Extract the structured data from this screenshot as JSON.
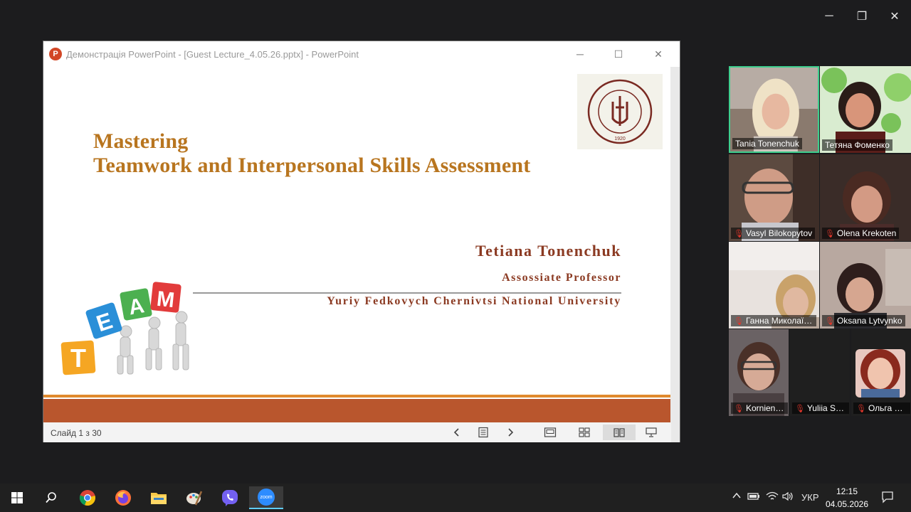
{
  "window_controls": {
    "minimize": "─",
    "restore": "❐",
    "close": "✕"
  },
  "powerpoint": {
    "logo_letter": "P",
    "title": "Демонстрація PowerPoint - [Guest Lecture_4.05.26.pptx] - PowerPoint",
    "controls": {
      "minimize": "─",
      "maximize": "☐",
      "close": "✕"
    },
    "slide": {
      "title_line1": "Mastering",
      "title_line2": "Teamwork and Interpersonal Skills Assessment",
      "author": "Tetiana Tonenchuk",
      "role": "Assossiate Professor",
      "university": "Yuriy Fedkovych Chernivtsi National University",
      "seal_year": "1920",
      "team_letters": [
        "T",
        "E",
        "A",
        "M"
      ]
    },
    "status": {
      "slide_counter": "Слайд 1 з 30"
    }
  },
  "participants": [
    {
      "name": "Tania Tonenchuk",
      "muted": false,
      "active": true
    },
    {
      "name": "Тетяна Фоменко",
      "muted": false,
      "active": false
    },
    {
      "name": "Vasyl Bilokopytov",
      "muted": true,
      "active": false
    },
    {
      "name": "Olena Krekoten",
      "muted": true,
      "active": false
    },
    {
      "name": "Ганна Миколаїв...",
      "muted": true,
      "active": false
    },
    {
      "name": "Oksana Lytvynko",
      "muted": true,
      "active": false
    },
    {
      "name": "Kornienk...",
      "muted": true,
      "active": false
    },
    {
      "name": "Yuliia Sh...",
      "muted": true,
      "active": false
    },
    {
      "name": "Ольга Бе...",
      "muted": true,
      "active": false
    }
  ],
  "taskbar": {
    "zoom_label": "zoom",
    "language": "УКР",
    "time": "12:15",
    "date": "04.05.2026"
  },
  "colors": {
    "title_gold": "#b8751f",
    "subtitle_brown": "#8b3a22",
    "band_orange": "#b9562d",
    "active_speaker": "#3ecf8e"
  }
}
